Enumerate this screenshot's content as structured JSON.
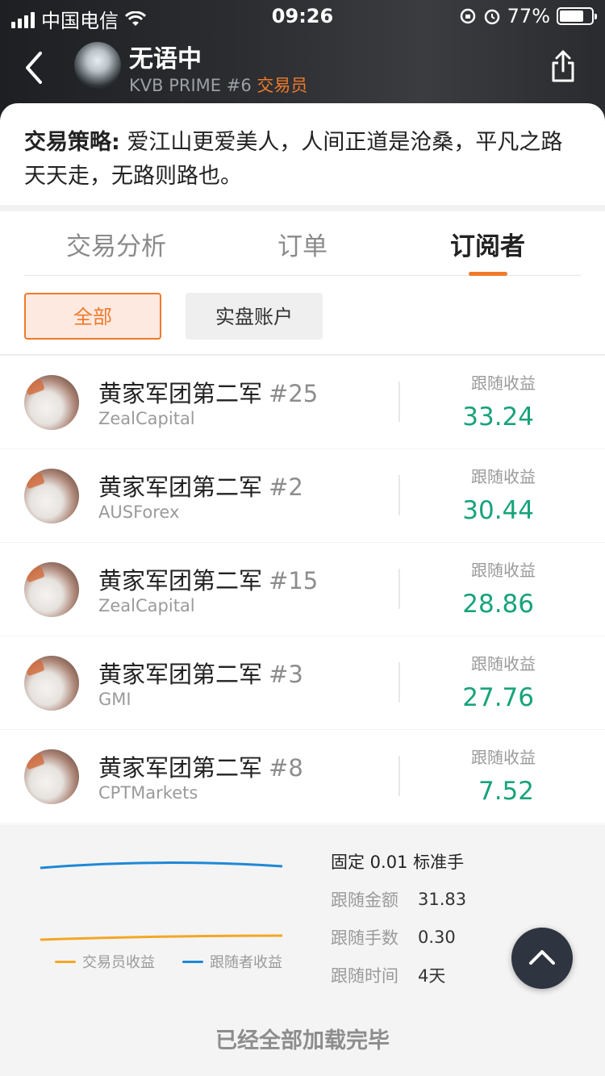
{
  "status_bar": {
    "carrier": "中国电信",
    "time": "09:26",
    "battery": "77%"
  },
  "header": {
    "title": "无语中",
    "subtitle_prefix": "KVB PRIME #6",
    "role": "交易员"
  },
  "strategy": {
    "label": "交易策略:",
    "text": " 爱江山更爱美人，人间正道是沧桑，平凡之路天天走，无路则路也。"
  },
  "tabs": [
    {
      "label": "交易分析"
    },
    {
      "label": "订单"
    },
    {
      "label": "订阅者"
    }
  ],
  "filters": {
    "all": "全部",
    "live": "实盘账户"
  },
  "subscribers": [
    {
      "name": "黄家军团第二军",
      "number": "#25",
      "broker": "ZealCapital",
      "label": "跟随收益",
      "value": "33.24"
    },
    {
      "name": "黄家军团第二军",
      "number": "#2",
      "broker": "AUSForex",
      "label": "跟随收益",
      "value": "30.44"
    },
    {
      "name": "黄家军团第二军",
      "number": "#15",
      "broker": "ZealCapital",
      "label": "跟随收益",
      "value": "28.86"
    },
    {
      "name": "黄家军团第二军",
      "number": "#3",
      "broker": "GMI",
      "label": "跟随收益",
      "value": "27.76"
    },
    {
      "name": "黄家军团第二军",
      "number": "#8",
      "broker": "CPTMarkets",
      "label": "跟随收益",
      "value": "7.52"
    }
  ],
  "bottom": {
    "legend_trader": "交易员收益",
    "legend_follower": "跟随者收益",
    "fixed": "固定 0.01 标准手",
    "stats": [
      {
        "k": "跟随金额",
        "v": "31.83"
      },
      {
        "k": "跟随手数",
        "v": "0.30"
      },
      {
        "k": "跟随时间",
        "v": "4天"
      }
    ],
    "end_text": "已经全部加载完毕"
  },
  "colors": {
    "accent": "#f07a2a",
    "profit_green": "#17a37c",
    "follower_line": "#1e88d6",
    "trader_line": "#f5a623"
  }
}
